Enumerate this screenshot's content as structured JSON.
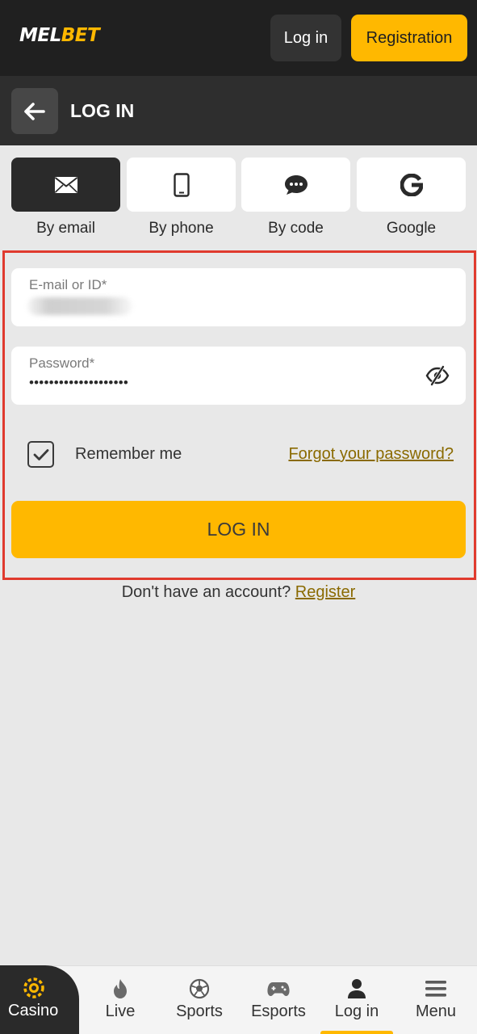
{
  "header": {
    "logo_main": "MELBET",
    "login_label": "Log in",
    "registration_label": "Registration"
  },
  "titlebar": {
    "title": "LOG IN"
  },
  "login_methods": [
    {
      "label": "By email",
      "icon": "envelope-icon",
      "active": true
    },
    {
      "label": "By phone",
      "icon": "phone-icon",
      "active": false
    },
    {
      "label": "By code",
      "icon": "chat-bubble-icon",
      "active": false
    },
    {
      "label": "Google",
      "icon": "google-icon",
      "active": false
    }
  ],
  "form": {
    "email_label": "E-mail or ID*",
    "password_label": "Password*",
    "password_value": "••••••••••••••••••••",
    "remember_label": "Remember me",
    "remember_checked": true,
    "forgot_label": "Forgot your password?",
    "submit_label": "LOG IN"
  },
  "signup": {
    "prompt": "Don't have an account?",
    "link": "Register"
  },
  "bottom_nav": [
    {
      "label": "Casino",
      "icon": "casino-chip-icon"
    },
    {
      "label": "Live",
      "icon": "flame-icon"
    },
    {
      "label": "Sports",
      "icon": "soccer-ball-icon"
    },
    {
      "label": "Esports",
      "icon": "gamepad-icon"
    },
    {
      "label": "Log in",
      "icon": "user-icon",
      "active": true
    },
    {
      "label": "Menu",
      "icon": "hamburger-icon"
    }
  ],
  "colors": {
    "accent": "#ffb800",
    "header_bg": "#202020",
    "highlight_border": "#e03a2e",
    "link": "#8a6a00"
  }
}
